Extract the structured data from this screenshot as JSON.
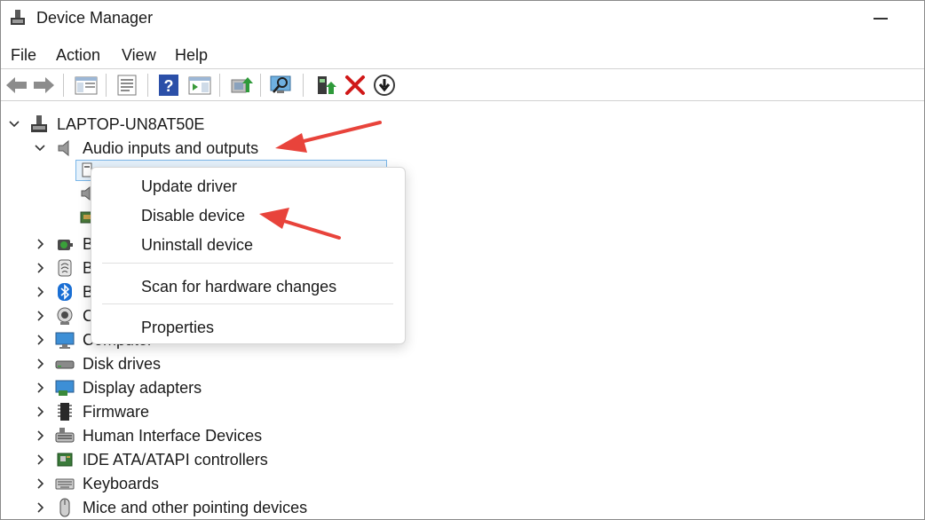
{
  "window": {
    "title": "Device Manager",
    "minimize_glyph": "minimize-icon"
  },
  "menubar": {
    "items": [
      {
        "label": "File"
      },
      {
        "label": "Action"
      },
      {
        "label": "View"
      },
      {
        "label": "Help"
      }
    ]
  },
  "toolbar": {
    "buttons": [
      "back-icon",
      "forward-icon",
      "show-hide-console-tree-icon",
      "properties-icon",
      "help-icon",
      "action-pane-icon",
      "update-driver-icon",
      "scan-hardware-icon",
      "enable-device-icon",
      "uninstall-icon",
      "disable-device-icon"
    ]
  },
  "tree": {
    "root": {
      "label": "LAPTOP-UN8AT50E"
    },
    "expanded_category": {
      "label": "Audio inputs and outputs"
    },
    "categories": [
      {
        "label": "B",
        "icon": "batteries-icon"
      },
      {
        "label": "B",
        "icon": "biometric-icon"
      },
      {
        "label": "B",
        "icon": "bluetooth-icon"
      },
      {
        "label": "C",
        "icon": "camera-icon"
      },
      {
        "label": "Computer",
        "icon": "computer-icon"
      },
      {
        "label": "Disk drives",
        "icon": "disk-drive-icon"
      },
      {
        "label": "Display adapters",
        "icon": "display-adapter-icon"
      },
      {
        "label": "Firmware",
        "icon": "firmware-icon"
      },
      {
        "label": "Human Interface Devices",
        "icon": "hid-icon"
      },
      {
        "label": "IDE ATA/ATAPI controllers",
        "icon": "ide-controller-icon"
      },
      {
        "label": "Keyboards",
        "icon": "keyboard-icon"
      },
      {
        "label": "Mice and other pointing devices",
        "icon": "mouse-icon"
      }
    ]
  },
  "context_menu": {
    "items": [
      {
        "label": "Update driver"
      },
      {
        "label": "Disable device"
      },
      {
        "label": "Uninstall device"
      },
      {
        "label": "Scan for hardware changes"
      },
      {
        "label": "Properties"
      }
    ]
  },
  "colors": {
    "accent_arrow": "#e8433b",
    "selection_bg": "#e5f1fb",
    "selection_border": "#7ab6e8"
  }
}
